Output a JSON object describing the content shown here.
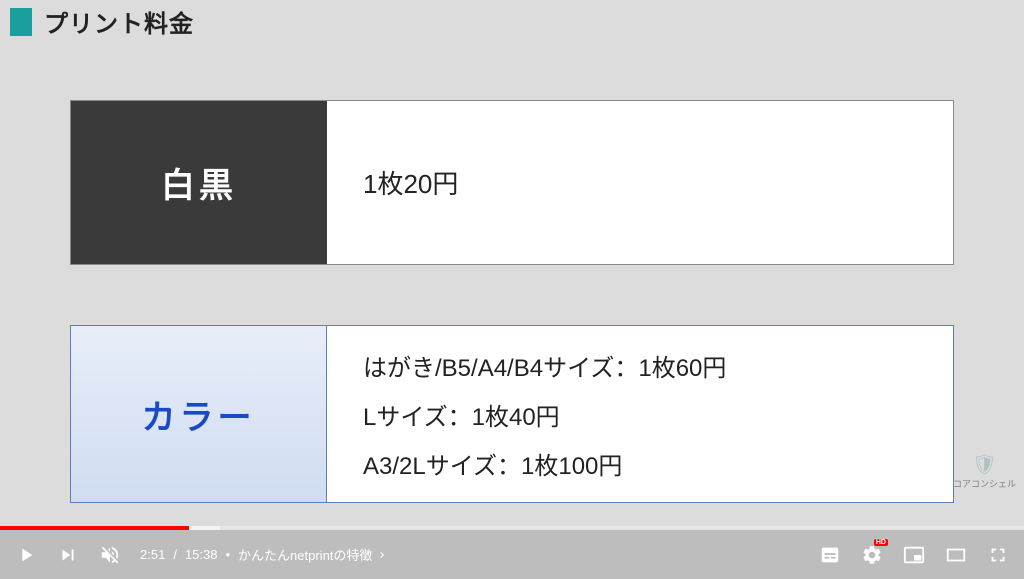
{
  "slide": {
    "title": "プリント料金",
    "rows": {
      "bw": {
        "label": "白黒",
        "price": "1枚20円"
      },
      "color": {
        "label": "カラー",
        "price1": "はがき/B5/A4/B4サイズ：1枚60円",
        "price2": "Lサイズ：1枚40円",
        "price3": "A3/2Lサイズ：1枚100円"
      }
    },
    "watermark": "コアコンシェル"
  },
  "player": {
    "current_time": "2:51",
    "duration": "15:38",
    "separator": "/",
    "chapter_sep": "•",
    "chapter_title": "かんたんnetprintの特徴",
    "hd": "HD"
  }
}
